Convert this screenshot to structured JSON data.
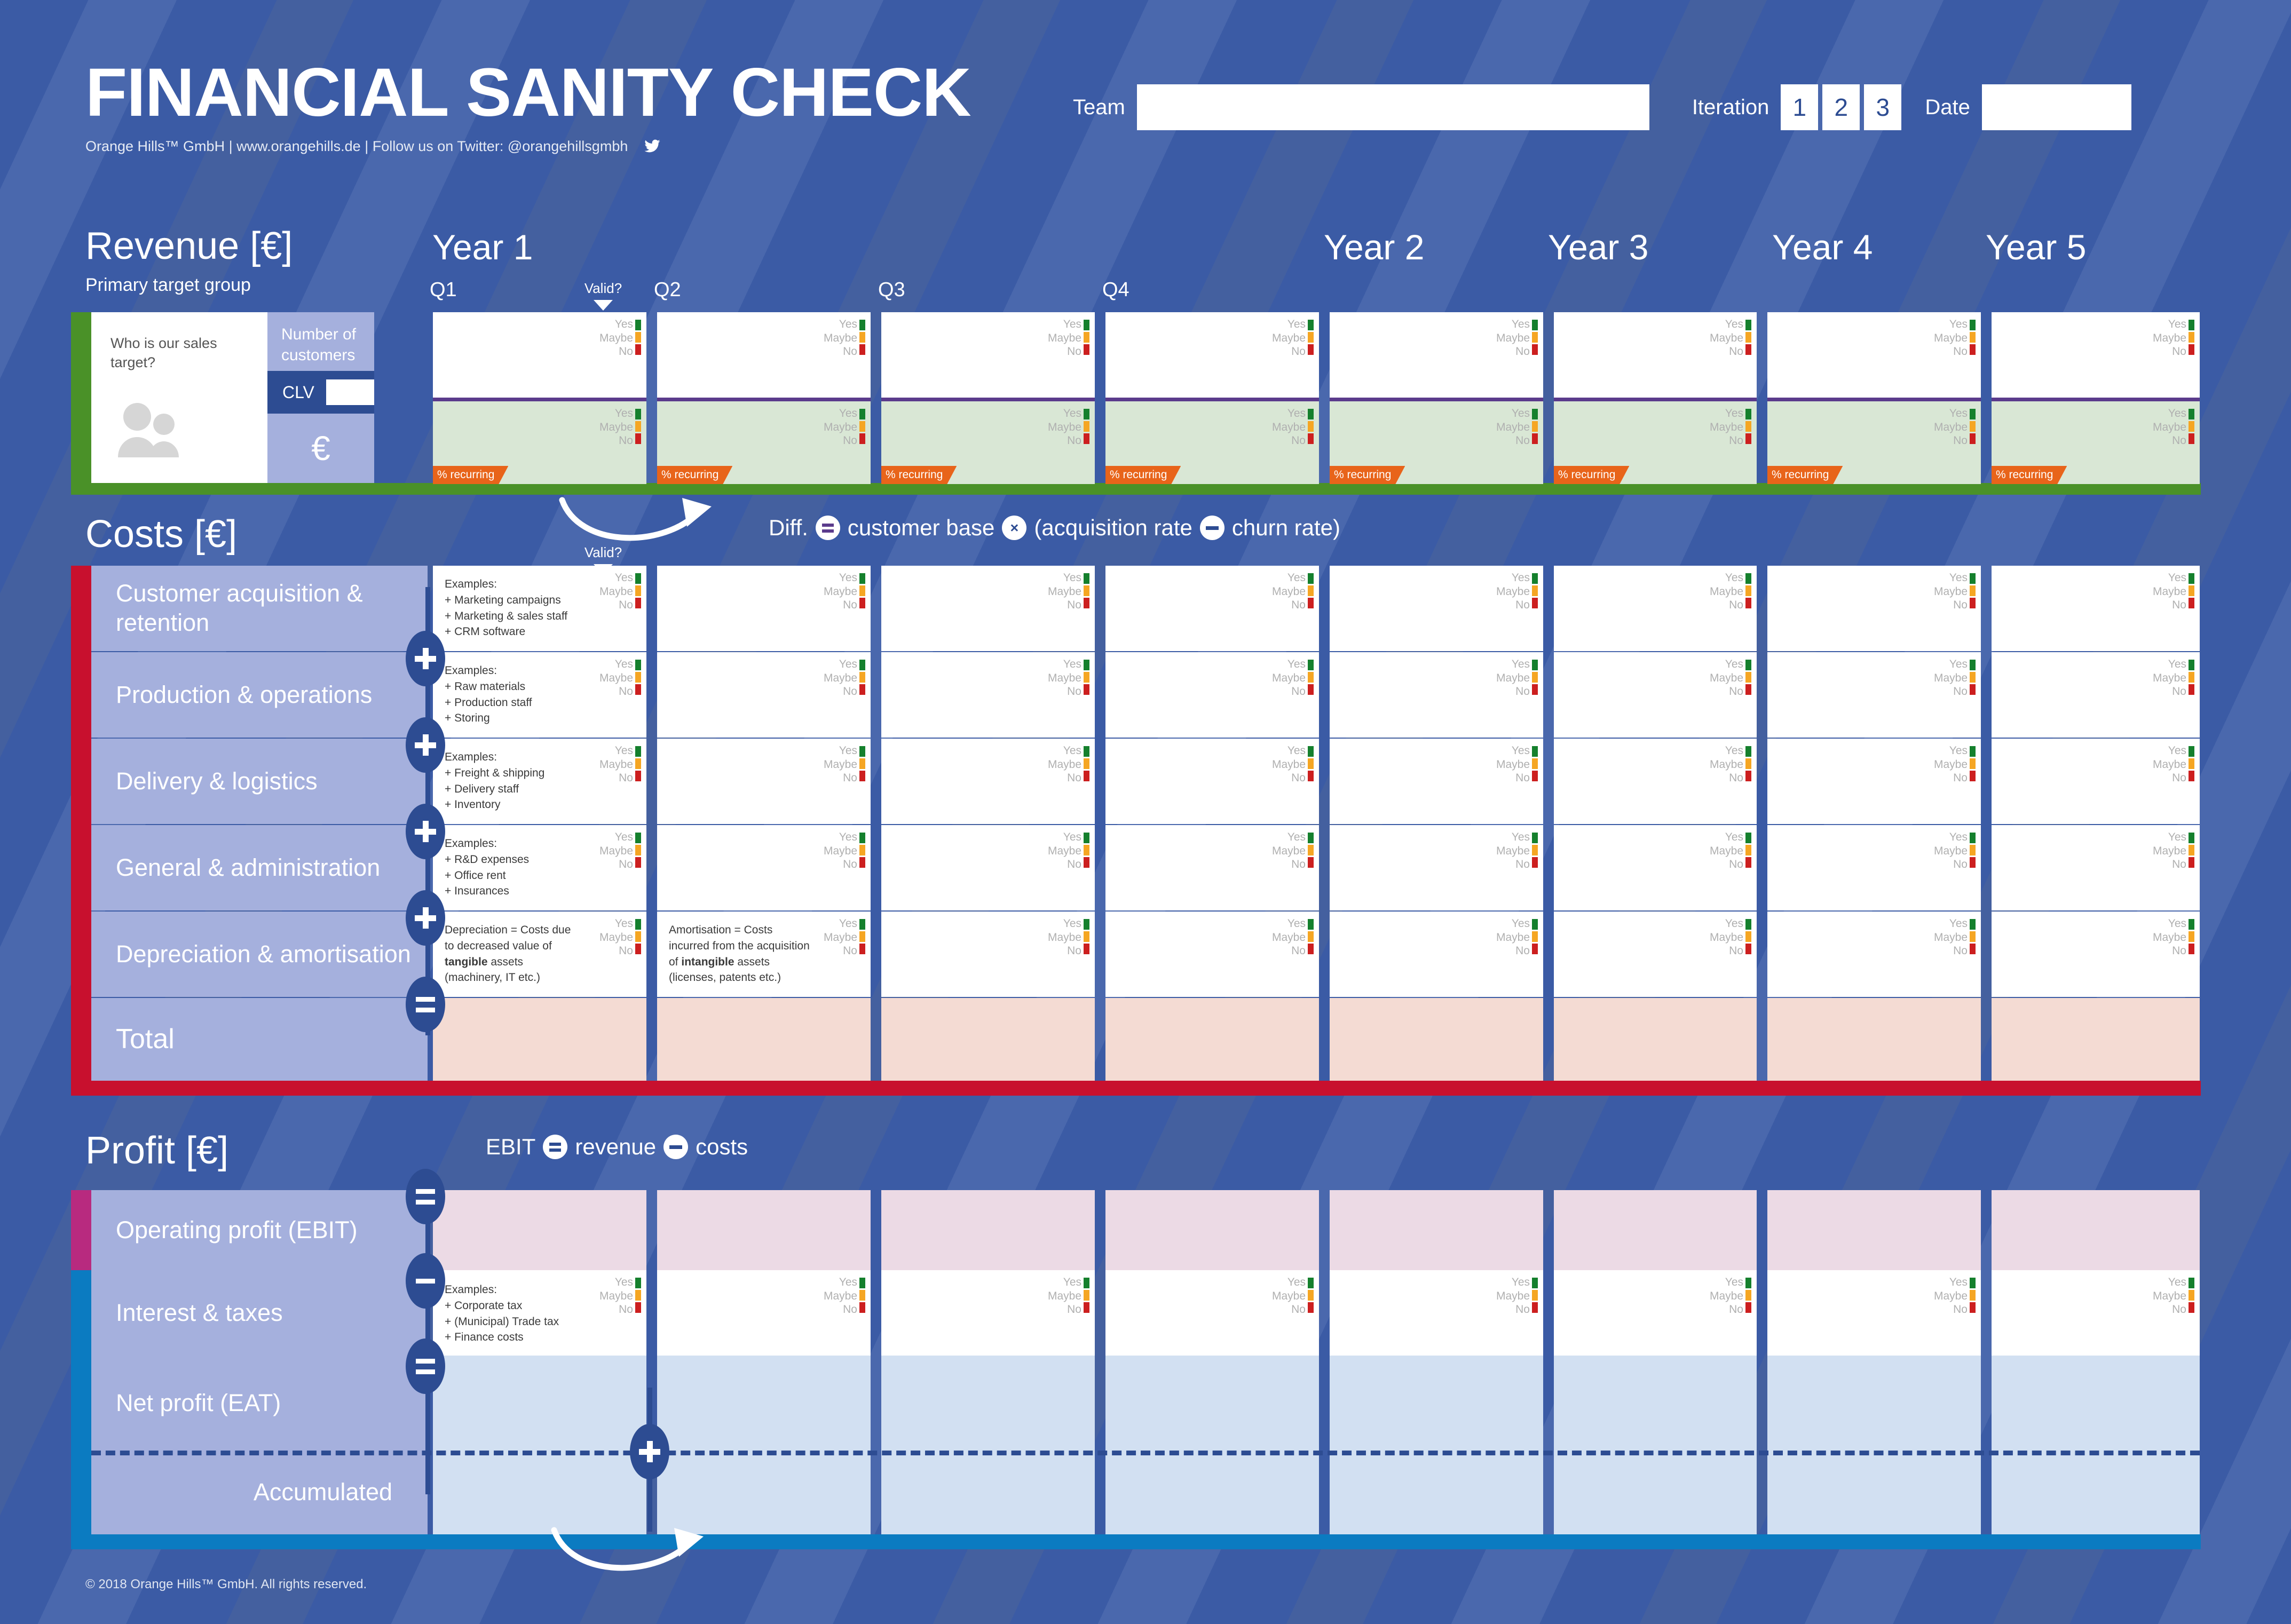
{
  "header": {
    "title": "FINANCIAL SANITY CHECK",
    "subtitle": "Orange Hills™ GmbH | www.orangehills.de | Follow us on Twitter: @orangehillsgmbh",
    "twitter_icon": "twitter-bird-icon",
    "team_label": "Team",
    "team_value": "",
    "iteration_label": "Iteration",
    "iteration_options": [
      "1",
      "2",
      "3"
    ],
    "date_label": "Date",
    "date_value": ""
  },
  "columns": {
    "years": [
      "Year 1",
      "Year 2",
      "Year 3",
      "Year 4",
      "Year 5"
    ],
    "quarters": [
      "Q1",
      "Q2",
      "Q3",
      "Q4"
    ],
    "valid_label": "Valid?"
  },
  "validation": {
    "yes": "Yes",
    "maybe": "Maybe",
    "no": "No",
    "color_yes": "#15802d",
    "color_maybe": "#f5a623",
    "color_no": "#cc1f1f"
  },
  "revenue": {
    "title": "Revenue [€]",
    "subtitle": "Primary target group",
    "spine_color": "#4a9128",
    "target_question": "Who is our sales target?",
    "people_icon": "people-icon",
    "number_of_customers": "Number of customers",
    "clv_label": "CLV",
    "clv_value": "",
    "euro_symbol": "€",
    "recurring_tag": "% recurring",
    "diff_formula": {
      "lead": "Diff.",
      "op1": "=",
      "t1": "customer base",
      "op2": "×",
      "t2": "(acquisition rate",
      "op3": "−",
      "t3": "churn rate)"
    }
  },
  "costs": {
    "title": "Costs [€]",
    "spine_color": "#c8102e",
    "rows": [
      {
        "label": "Customer acquisition & retention",
        "examples_title": "Examples:",
        "examples": [
          "+ Marketing campaigns",
          "+ Marketing & sales staff",
          "+ CRM software"
        ],
        "operator": "+"
      },
      {
        "label": "Production & operations",
        "examples_title": "Examples:",
        "examples": [
          "+ Raw materials",
          "+ Production staff",
          "+ Storing"
        ],
        "operator": "+"
      },
      {
        "label": "Delivery & logistics",
        "examples_title": "Examples:",
        "examples": [
          "+ Freight & shipping",
          "+ Delivery staff",
          "+ Inventory"
        ],
        "operator": "+"
      },
      {
        "label": "General & administration",
        "examples_title": "Examples:",
        "examples": [
          "+ R&D expenses",
          "+ Office rent",
          "+ Insurances"
        ],
        "operator": "+"
      },
      {
        "label": "Depreciation & amortisation",
        "note_q1": "Depreciation = Costs due to decreased value of tangible assets (machinery, IT etc.)",
        "note_q1_bold": "tangible",
        "note_q2": "Amortisation = Costs incurred from the acquisition of intangible assets (licenses, patents etc.)",
        "note_q2_bold": "intangible",
        "operator": "="
      }
    ],
    "total_label": "Total"
  },
  "profit": {
    "title": "Profit [€]",
    "spine_color_operating": "#b82a7f",
    "spine_color_net": "#0b7bc1",
    "ebit_formula": {
      "lead": "EBIT",
      "op1": "=",
      "t1": "revenue",
      "op2": "−",
      "t2": "costs"
    },
    "rows": [
      {
        "label": "Operating profit (EBIT)",
        "operator": "="
      },
      {
        "label": "Interest & taxes",
        "examples_title": "Examples:",
        "examples": [
          "+ Corporate tax",
          "+ (Municipal) Trade tax",
          "+ Finance costs"
        ],
        "operator": "−"
      },
      {
        "label": "Net profit (EAT)",
        "operator": "="
      },
      {
        "label": "Accumulated",
        "operator": "+"
      }
    ]
  },
  "footer": {
    "copyright": "© 2018 Orange Hills™ GmbH. All rights reserved."
  }
}
